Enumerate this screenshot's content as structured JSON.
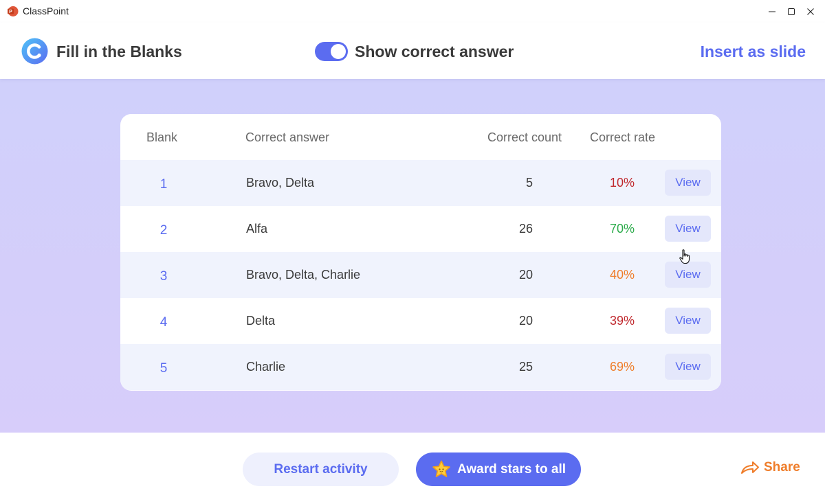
{
  "window": {
    "app_name": "ClassPoint"
  },
  "header": {
    "title": "Fill in the Blanks",
    "toggle_label": "Show correct answer",
    "toggle_on": true,
    "insert_label": "Insert as slide"
  },
  "table": {
    "columns": [
      "Blank",
      "Correct answer",
      "Correct count",
      "Correct rate"
    ],
    "rows": [
      {
        "blank": "1",
        "answer": "Bravo, Delta",
        "count": "5",
        "rate": "10%",
        "rate_color": "#c0282d",
        "view": "View"
      },
      {
        "blank": "2",
        "answer": "Alfa",
        "count": "26",
        "rate": "70%",
        "rate_color": "#2bab4a",
        "view": "View"
      },
      {
        "blank": "3",
        "answer": "Bravo, Delta, Charlie",
        "count": "20",
        "rate": "40%",
        "rate_color": "#ef7d2a",
        "view": "View"
      },
      {
        "blank": "4",
        "answer": "Delta",
        "count": "20",
        "rate": "39%",
        "rate_color": "#c0282d",
        "view": "View"
      },
      {
        "blank": "5",
        "answer": "Charlie",
        "count": "25",
        "rate": "69%",
        "rate_color": "#ef7d2a",
        "view": "View"
      }
    ]
  },
  "footer": {
    "restart_label": "Restart activity",
    "award_label": "Award stars to all",
    "share_label": "Share"
  },
  "colors": {
    "accent": "#5b6cf0",
    "share": "#ef7d2a",
    "background_band": "#d3d0fb"
  }
}
